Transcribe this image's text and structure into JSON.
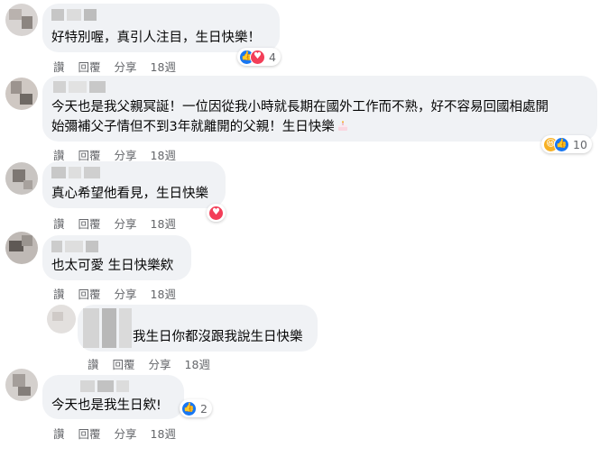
{
  "actions": {
    "like": "讚",
    "reply": "回覆",
    "share": "分享",
    "time": "18週"
  },
  "comments": [
    {
      "text_lines": [
        "好特別喔，真引人注目，生日快樂！"
      ],
      "reactions": [
        "like",
        "love"
      ],
      "count": "4"
    },
    {
      "text_lines": [
        "今天也是我父親冥誕！一位因從我小時就長期在國外工作而不熟，好不容易回國相處開",
        "始彌補父子情但不到3年就離開的父親！生日快樂"
      ],
      "has_emoji": "birthday-cake",
      "reactions": [
        "haha",
        "like"
      ],
      "count": "10"
    },
    {
      "text_lines": [
        "真心希望他看見，生日快樂"
      ],
      "reactions": [
        "love"
      ],
      "count": ""
    },
    {
      "text_lines": [
        "也太可愛 生日快樂欸"
      ],
      "reactions": [],
      "count": ""
    },
    {
      "text_lines": [
        "我生日你都沒跟我說生日快樂"
      ],
      "reactions": [],
      "count": "",
      "is_reply": true
    },
    {
      "text_lines": [
        "今天也是我生日欸!"
      ],
      "reactions": [
        "like"
      ],
      "count": "2"
    }
  ],
  "colors": {
    "bubble": "#f0f2f5",
    "secondary_text": "#65676b",
    "like": "#1877f2",
    "love": "#f33e58"
  }
}
